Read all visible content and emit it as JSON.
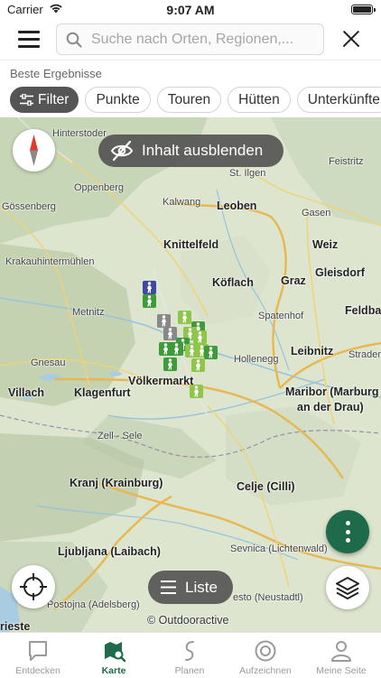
{
  "status_bar": {
    "carrier": "Carrier",
    "time": "9:07 AM"
  },
  "search": {
    "placeholder": "Suche nach Orten, Regionen,..."
  },
  "results": {
    "label": "Beste Ergebnisse",
    "chips": [
      "Filter",
      "Punkte",
      "Touren",
      "Hütten",
      "Unterkünfte"
    ]
  },
  "map": {
    "hide_content_label": "Inhalt ausblenden",
    "list_label": "Liste",
    "attribution": "© Outdooractive",
    "places": {
      "hinterstoder": "Hinterstoder",
      "feistritz": "Feistritz",
      "st_ilgen": "St. Ilgen",
      "oppenberg": "Oppenberg",
      "gossenberg": "Gössenberg",
      "kalwang": "Kalwang",
      "leoben": "Leoben",
      "gasen": "Gasen",
      "knittelfeld": "Knittelfeld",
      "weiz": "Weiz",
      "krakauhintermuehlen": "Krakauhintermühlen",
      "koeflach": "Köflach",
      "graz": "Graz",
      "gleisdorf": "Gleisdorf",
      "metnitz": "Metnitz",
      "spatenhof": "Spatenhof",
      "feldbach": "Feldbac",
      "gnesau": "Gnesau",
      "hollenegg": "Hollenegg",
      "leibnitz": "Leibnitz",
      "straden": "Straden",
      "voelkermarkt": "Völkermarkt",
      "villach": "Villach",
      "klagenfurt": "Klagenfurt",
      "maribor_1": "Maribor (Marburg",
      "maribor_2": "an der Drau)",
      "zell_sele": "Zell - Sele",
      "kranj": "Kranj (Krainburg)",
      "celje": "Celje (Cilli)",
      "sevnica": "Sevnica (Lichtenwald)",
      "ljubljana": "Ljubljana (Laibach)",
      "novo_mesto": "esto (Neustadtl)",
      "postojna": "Postojna (Adelsberg)",
      "trieste": "rieste"
    }
  },
  "tabs": [
    {
      "label": "Entdecken",
      "icon": "discover-icon",
      "active": false
    },
    {
      "label": "Karte",
      "icon": "map-icon",
      "active": true
    },
    {
      "label": "Planen",
      "icon": "route-icon",
      "active": false
    },
    {
      "label": "Aufzeichnen",
      "icon": "record-icon",
      "active": false
    },
    {
      "label": "Meine Seite",
      "icon": "profile-icon",
      "active": false
    }
  ],
  "colors": {
    "accent": "#1d6b4b",
    "marker_green": "#3d9b3a",
    "marker_light_green": "#8fc64a",
    "marker_blue": "#3e4aa0",
    "compass_red": "#e03a2f"
  }
}
